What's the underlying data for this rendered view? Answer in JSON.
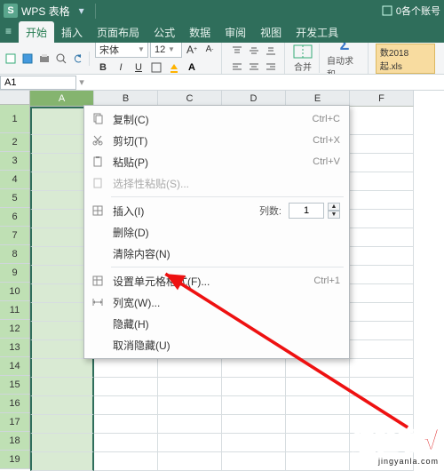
{
  "titlebar": {
    "app_name": "WPS 表格",
    "account": "0各个账号"
  },
  "tabs": {
    "menu_icon": "≡",
    "items": [
      "开始",
      "插入",
      "页面布局",
      "公式",
      "数据",
      "审阅",
      "视图",
      "开发工具"
    ],
    "active_index": 0
  },
  "doc_name": "数2018起.xls",
  "font": {
    "name": "宋体",
    "size": "12"
  },
  "ribbon_labels": {
    "merge": "合并",
    "autosum": "自动求和"
  },
  "namebox": {
    "value": "A1"
  },
  "columns": [
    "A",
    "B",
    "C",
    "D",
    "E",
    "F"
  ],
  "rows": [
    "1",
    "2",
    "3",
    "4",
    "5",
    "6",
    "7",
    "8",
    "9",
    "10",
    "11",
    "12",
    "13",
    "14",
    "15",
    "16",
    "17",
    "18",
    "19"
  ],
  "context_menu": {
    "copy": {
      "label": "复制(C)",
      "accel": "Ctrl+C"
    },
    "cut": {
      "label": "剪切(T)",
      "accel": "Ctrl+X"
    },
    "paste": {
      "label": "粘贴(P)",
      "accel": "Ctrl+V"
    },
    "pspecial": {
      "label": "选择性粘贴(S)..."
    },
    "insert": {
      "label": "插入(I)",
      "cols_label": "列数:",
      "cols_value": "1"
    },
    "delete": {
      "label": "删除(D)"
    },
    "clear": {
      "label": "清除内容(N)"
    },
    "format": {
      "label": "设置单元格格式(F)...",
      "accel": "Ctrl+1"
    },
    "colw": {
      "label": "列宽(W)..."
    },
    "hide": {
      "label": "隐藏(H)"
    },
    "unhide": {
      "label": "取消隐藏(U)"
    }
  },
  "watermark": {
    "brand": "经验啦",
    "url": "jingyanla.com"
  }
}
